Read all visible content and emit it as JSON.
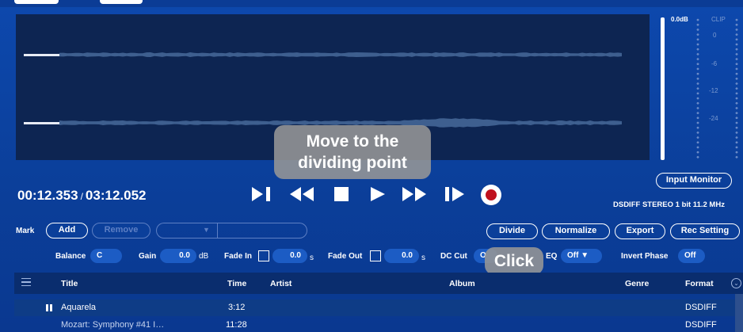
{
  "tooltips": {
    "move_line1": "Move to the",
    "move_line2": "dividing point",
    "click": "Click"
  },
  "meter": {
    "db": "0.0dB",
    "clip": "CLIP",
    "ticks": [
      "0",
      "-6",
      "-12",
      "-24"
    ]
  },
  "input_monitor_label": "Input Monitor",
  "time": {
    "current": "00:12.353",
    "separator": "/",
    "total": "03:12.052"
  },
  "status": "DSDIFF STEREO 1 bit 11.2 MHz",
  "mark": {
    "label": "Mark",
    "add": "Add",
    "remove": "Remove"
  },
  "actions": {
    "divide": "Divide",
    "normalize": "Normalize",
    "export": "Export",
    "rec_setting": "Rec Setting"
  },
  "settings": {
    "balance_label": "Balance",
    "balance_value": "C",
    "gain_label": "Gain",
    "gain_value": "0.0",
    "gain_unit": "dB",
    "fade_in_label": "Fade In",
    "fade_in_value": "0.0",
    "fade_in_unit": "s",
    "fade_out_label": "Fade Out",
    "fade_out_value": "0.0",
    "fade_out_unit": "s",
    "dc_cut_label": "DC Cut",
    "dc_cut_value": "O",
    "eq_label": "EQ",
    "eq_value": "Off ▼",
    "invert_phase_label": "Invert Phase",
    "invert_phase_value": "Off"
  },
  "table": {
    "headers": {
      "title": "Title",
      "time": "Time",
      "artist": "Artist",
      "album": "Album",
      "genre": "Genre",
      "format": "Format"
    },
    "rows": [
      {
        "title": "Aquarela",
        "time": "3:12",
        "format": "DSDIFF"
      },
      {
        "title": "Mozart: Symphony #41 I…",
        "time": "11:28",
        "format": "DSDIFF"
      }
    ]
  },
  "icons": [
    "skip-to-mark-icon",
    "rewind-icon",
    "stop-icon",
    "play-icon",
    "fast-forward-icon",
    "next-mark-icon",
    "record-icon",
    "menu-icon",
    "column-toggle-icon",
    "pause-icon"
  ],
  "colors": {
    "background": "#0b3f9a",
    "waveform_bg": "#0d2552",
    "record": "#c0111e",
    "tooltip": "#969696"
  }
}
